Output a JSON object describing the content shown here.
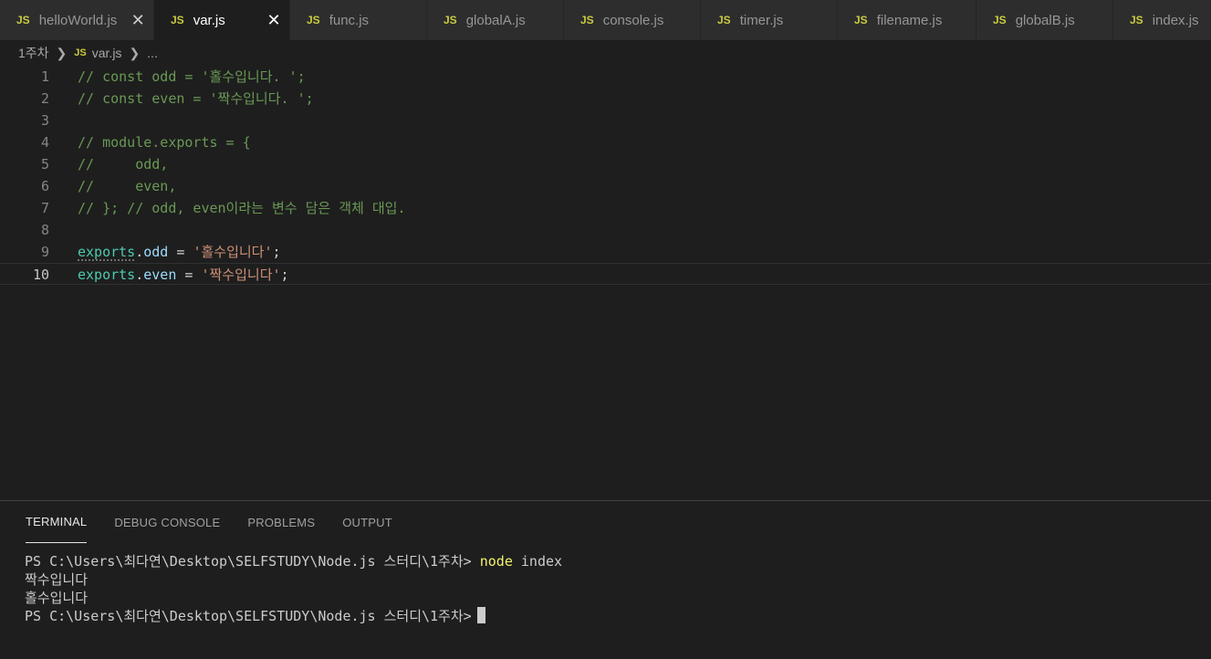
{
  "tabs": [
    {
      "label": "helloWorld.js",
      "icon": "js-file-icon",
      "active": false,
      "closable": true
    },
    {
      "label": "var.js",
      "icon": "js-file-icon",
      "active": true,
      "closable": true
    },
    {
      "label": "func.js",
      "icon": "js-file-icon",
      "active": false,
      "closable": false
    },
    {
      "label": "globalA.js",
      "icon": "js-file-icon",
      "active": false,
      "closable": false
    },
    {
      "label": "console.js",
      "icon": "js-file-icon",
      "active": false,
      "closable": false
    },
    {
      "label": "timer.js",
      "icon": "js-file-icon",
      "active": false,
      "closable": false
    },
    {
      "label": "filename.js",
      "icon": "js-file-icon",
      "active": false,
      "closable": false
    },
    {
      "label": "globalB.js",
      "icon": "js-file-icon",
      "active": false,
      "closable": false
    },
    {
      "label": "index.js",
      "icon": "js-file-icon",
      "active": false,
      "closable": false
    }
  ],
  "tab_icon_text": "JS",
  "close_glyph": "✕",
  "breadcrumb": {
    "folder": "1주차",
    "file": "var.js",
    "more": "..."
  },
  "editor": {
    "lines": [
      {
        "num": "1",
        "text": "// const odd = '홀수입니다. ';"
      },
      {
        "num": "2",
        "text": "// const even = '짝수입니다. ';"
      },
      {
        "num": "3",
        "text": ""
      },
      {
        "num": "4",
        "text": "// module.exports = {"
      },
      {
        "num": "5",
        "text": "//     odd,"
      },
      {
        "num": "6",
        "text": "//     even,"
      },
      {
        "num": "7",
        "text": "// }; // odd, even이라는 변수 담은 객체 대입."
      },
      {
        "num": "8",
        "text": ""
      },
      {
        "num": "9",
        "obj": "exports",
        "prop": "odd",
        "op": " = ",
        "str": "'홀수입니다'",
        "end": ";"
      },
      {
        "num": "10",
        "obj": "exports",
        "prop": "even",
        "op": " = ",
        "str": "'짝수입니다'",
        "end": ";"
      }
    ]
  },
  "panel": {
    "tabs": [
      "TERMINAL",
      "DEBUG CONSOLE",
      "PROBLEMS",
      "OUTPUT"
    ],
    "active_tab": "TERMINAL",
    "terminal": {
      "prompt1": "PS C:\\Users\\최다연\\Desktop\\SELFSTUDY\\Node.js 스터디\\1주차> ",
      "command": "node",
      "args": " index",
      "output1": "짝수입니다",
      "output2": "홀수입니다",
      "prompt2": "PS C:\\Users\\최다연\\Desktop\\SELFSTUDY\\Node.js 스터디\\1주차>"
    }
  },
  "colors": {
    "comment": "#6a9955",
    "variable": "#4ec9b0",
    "property": "#9cdcfe",
    "string": "#ce9178",
    "js_icon": "#cbcb41",
    "terminal_command": "#f2f26f"
  }
}
